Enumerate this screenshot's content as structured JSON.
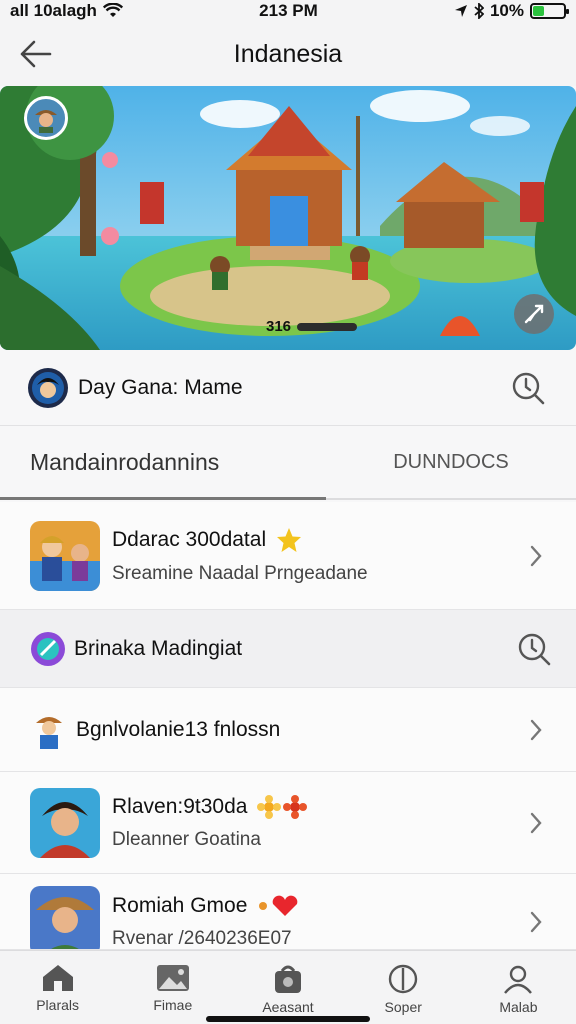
{
  "status_bar": {
    "carrier": "all 10alagh",
    "time": "213 PM",
    "battery_percent": "10%",
    "battery_level": 0.35
  },
  "nav": {
    "title": "Indanesia",
    "back_icon": "back-arrow-icon"
  },
  "hero": {
    "counter_text": "316",
    "corner_icon": "expand-icon"
  },
  "featured": {
    "label": "Day Gana: Mame",
    "icon": "clock-search-icon"
  },
  "tabs": [
    {
      "label": "Mandainrodannins",
      "active": true
    },
    {
      "label": "DUNNDOCS",
      "active": false
    }
  ],
  "list": [
    {
      "title": "Ddarac 300datal",
      "subtitle": "Sreamine Naadal Prngeadane",
      "badge_icon": "star-icon"
    },
    {
      "title": "Brinaka Madingiat",
      "subtitle": "",
      "icon": "clock-search-icon"
    },
    {
      "title": "Bgnlvolanie13 fnlossn",
      "subtitle": ""
    },
    {
      "title": "Rlaven:9t30da",
      "subtitle": "Dleanner Goatina",
      "badge_icon": "flower-icon"
    },
    {
      "title": "Romiah Gmoe",
      "subtitle": "Rvenar /2640236E07",
      "badge_icon": "heart-icon"
    }
  ],
  "tab_bar": [
    {
      "label": "Plarals",
      "icon": "home-icon"
    },
    {
      "label": "Fimae",
      "icon": "gallery-icon"
    },
    {
      "label": "Aeasant",
      "icon": "bag-icon"
    },
    {
      "label": "Soper",
      "icon": "compass-icon"
    },
    {
      "label": "Malab",
      "icon": "profile-icon"
    }
  ],
  "colors": {
    "accent": "#2bc23e",
    "star": "#f3c31d",
    "heart": "#e8262d"
  }
}
